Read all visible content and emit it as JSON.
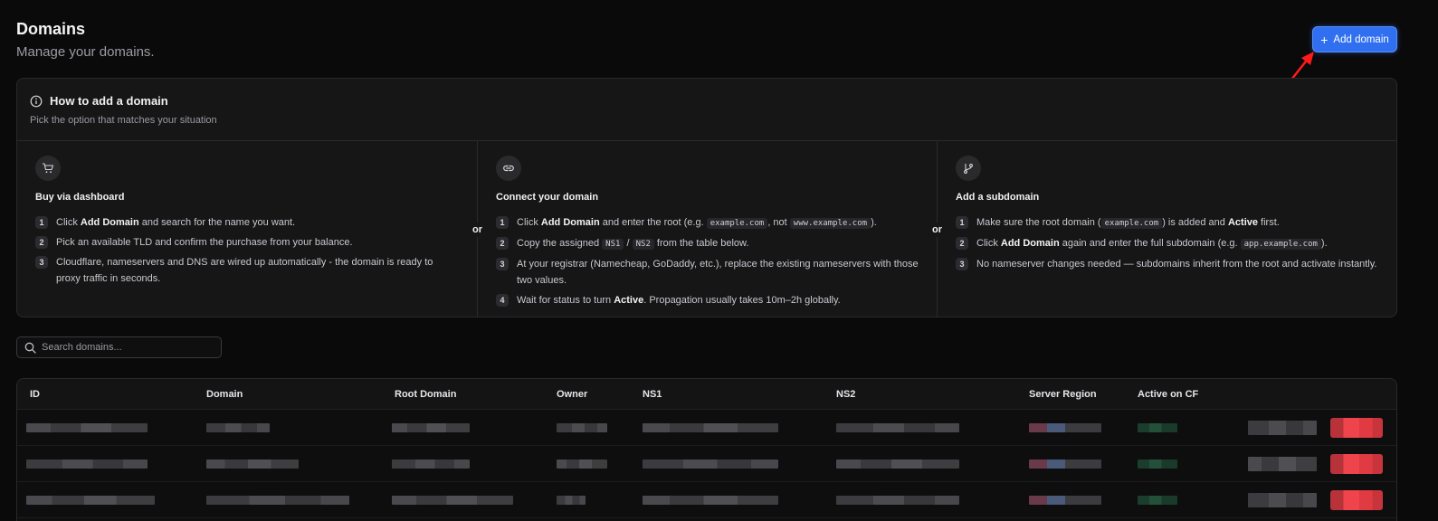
{
  "header": {
    "title": "Domains",
    "subtitle": "Manage your domains."
  },
  "actions": {
    "add_label": "Add domain"
  },
  "howto": {
    "title": "How to add a domain",
    "description": "Pick the option that matches your situation",
    "separator": "or",
    "columns": [
      {
        "icon": "cart-icon",
        "title": "Buy via dashboard",
        "steps": [
          {
            "num": "1",
            "pre": "Click ",
            "bold": "Add Domain",
            "post": " and search for the name you want."
          },
          {
            "num": "2",
            "text": "Pick an available TLD and confirm the purchase from your balance."
          },
          {
            "num": "3",
            "text": "Cloudflare, nameservers and DNS are wired up automatically - the domain is ready to proxy traffic in seconds."
          }
        ]
      },
      {
        "icon": "link-icon",
        "title": "Connect your domain",
        "steps": [
          {
            "num": "1",
            "pre": "Click ",
            "bold": "Add Domain",
            "mid": " and enter the root (e.g. ",
            "code1": "example.com",
            "mid2": ", not ",
            "code2": "www.example.com",
            "post": ")."
          },
          {
            "num": "2",
            "pre": "Copy the assigned ",
            "code1": "NS1",
            "mid": " / ",
            "code2": "NS2",
            "post": " from the table below."
          },
          {
            "num": "3",
            "text": "At your registrar (Namecheap, GoDaddy, etc.), replace the existing nameservers with those two values."
          },
          {
            "num": "4",
            "pre": "Wait for status to turn ",
            "bold": "Active",
            "post": ". Propagation usually takes 10m–2h globally."
          }
        ]
      },
      {
        "icon": "git-branch-icon",
        "title": "Add a subdomain",
        "steps": [
          {
            "num": "1",
            "pre": "Make sure the root domain (",
            "code1": "example.com",
            "mid": ") is added and ",
            "bold": "Active",
            "post": " first."
          },
          {
            "num": "2",
            "pre": "Click ",
            "bold": "Add Domain",
            "mid": " again and enter the full subdomain (e.g. ",
            "code1": "app.example.com",
            "post": ")."
          },
          {
            "num": "3",
            "text": "No nameserver changes needed — subdomains inherit from the root and activate instantly."
          }
        ]
      }
    ]
  },
  "search": {
    "placeholder": "Search domains..."
  },
  "table": {
    "columns": [
      "ID",
      "Domain",
      "Root Domain",
      "Owner",
      "NS1",
      "NS2",
      "Server Region",
      "Active on CF"
    ]
  },
  "colors": {
    "accent": "#2f6ff0",
    "background": "#0a0a0b",
    "card": "#161617",
    "annotation_arrow": "#ff1a1a"
  }
}
